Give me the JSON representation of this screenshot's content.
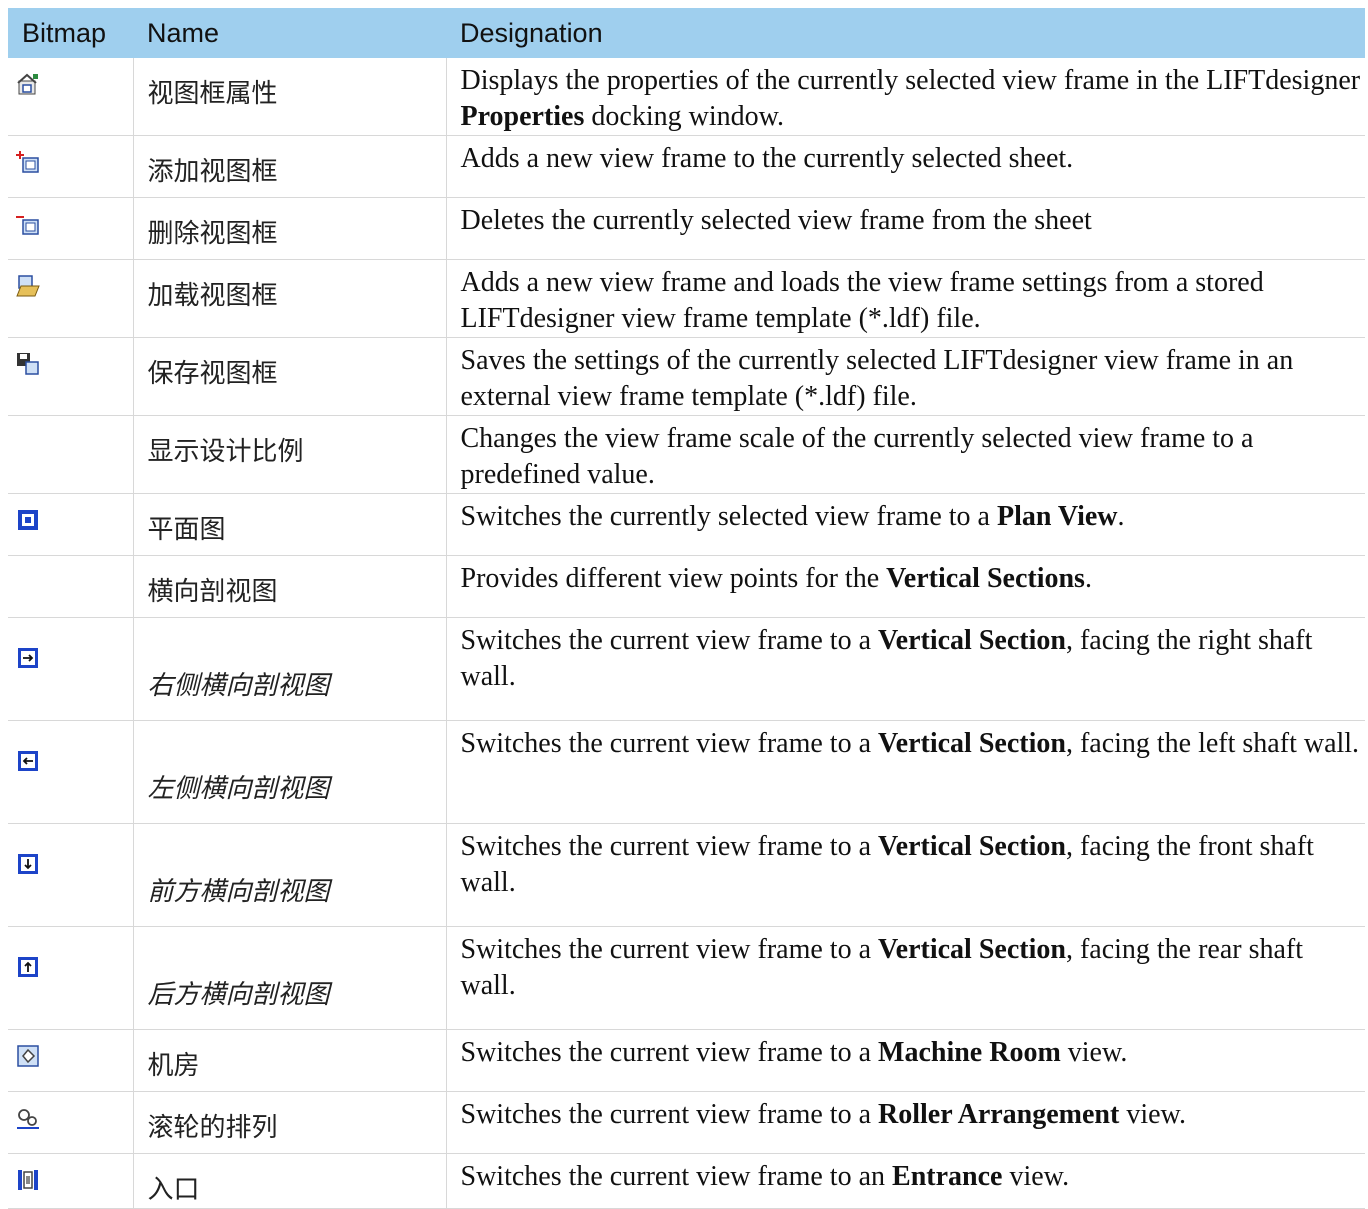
{
  "headers": [
    "Bitmap",
    "Name",
    "Designation"
  ],
  "rows": [
    {
      "icon": "view-frame-properties-icon",
      "name": "视图框属性",
      "sub": false,
      "parts": [
        "Displays the properties of the currently selected view frame in the LIFTdesigner ",
        "Properties",
        " docking window."
      ]
    },
    {
      "icon": "add-view-frame-icon",
      "name": "添加视图框",
      "sub": false,
      "parts": [
        "Adds a new view frame to the currently selected sheet.",
        "",
        ""
      ]
    },
    {
      "icon": "delete-view-frame-icon",
      "name": "删除视图框",
      "sub": false,
      "parts": [
        "Deletes the currently selected view frame from the sheet",
        "",
        ""
      ]
    },
    {
      "icon": "load-view-frame-icon",
      "name": "加载视图框",
      "sub": false,
      "parts": [
        "Adds a new view frame and loads the view frame settings from a stored LIFTdesigner view frame template (*.ldf) file.",
        "",
        ""
      ]
    },
    {
      "icon": "save-view-frame-icon",
      "name": "保存视图框",
      "sub": false,
      "parts": [
        "Saves the settings of the currently selected LIFTdesigner view frame in an external view frame template (*.ldf) file.",
        "",
        ""
      ]
    },
    {
      "icon": "",
      "name": "显示设计比例",
      "sub": false,
      "parts": [
        "Changes the view frame scale of the currently selected view frame to a predefined value.",
        "",
        ""
      ]
    },
    {
      "icon": "plan-view-icon",
      "name": "平面图",
      "sub": false,
      "parts": [
        "Switches the currently selected view frame to a ",
        "Plan View",
        "."
      ]
    },
    {
      "icon": "",
      "name": "横向剖视图",
      "sub": false,
      "parts": [
        "Provides different view points for the ",
        "Vertical Sections",
        "."
      ]
    },
    {
      "icon": "section-right-icon",
      "name": "右侧横向剖视图",
      "sub": true,
      "parts": [
        "Switches the current view frame to a ",
        "Vertical Section",
        ", facing the right shaft wall."
      ]
    },
    {
      "icon": "section-left-icon",
      "name": "左侧横向剖视图",
      "sub": true,
      "parts": [
        "Switches the current view frame to a ",
        "Vertical Section",
        ", facing the left shaft wall."
      ]
    },
    {
      "icon": "section-front-icon",
      "name": "前方横向剖视图",
      "sub": true,
      "parts": [
        "Switches the current view frame to a ",
        "Vertical Section",
        ", facing the front shaft wall."
      ]
    },
    {
      "icon": "section-rear-icon",
      "name": "后方横向剖视图",
      "sub": true,
      "parts": [
        "Switches the current view frame to a ",
        "Vertical Section",
        ", facing the rear shaft wall."
      ]
    },
    {
      "icon": "machine-room-icon",
      "name": "机房",
      "sub": false,
      "parts": [
        "Switches the current view frame to a ",
        "Machine Room",
        " view."
      ]
    },
    {
      "icon": "roller-arrangement-icon",
      "name": "滚轮的排列",
      "sub": false,
      "parts": [
        "Switches the current view frame to a ",
        "Roller Arrangement",
        " view."
      ]
    },
    {
      "icon": "entrance-icon",
      "name": "入口",
      "sub": false,
      "parts": [
        "Switches the current view frame to an ",
        "Entrance",
        " view."
      ]
    }
  ]
}
